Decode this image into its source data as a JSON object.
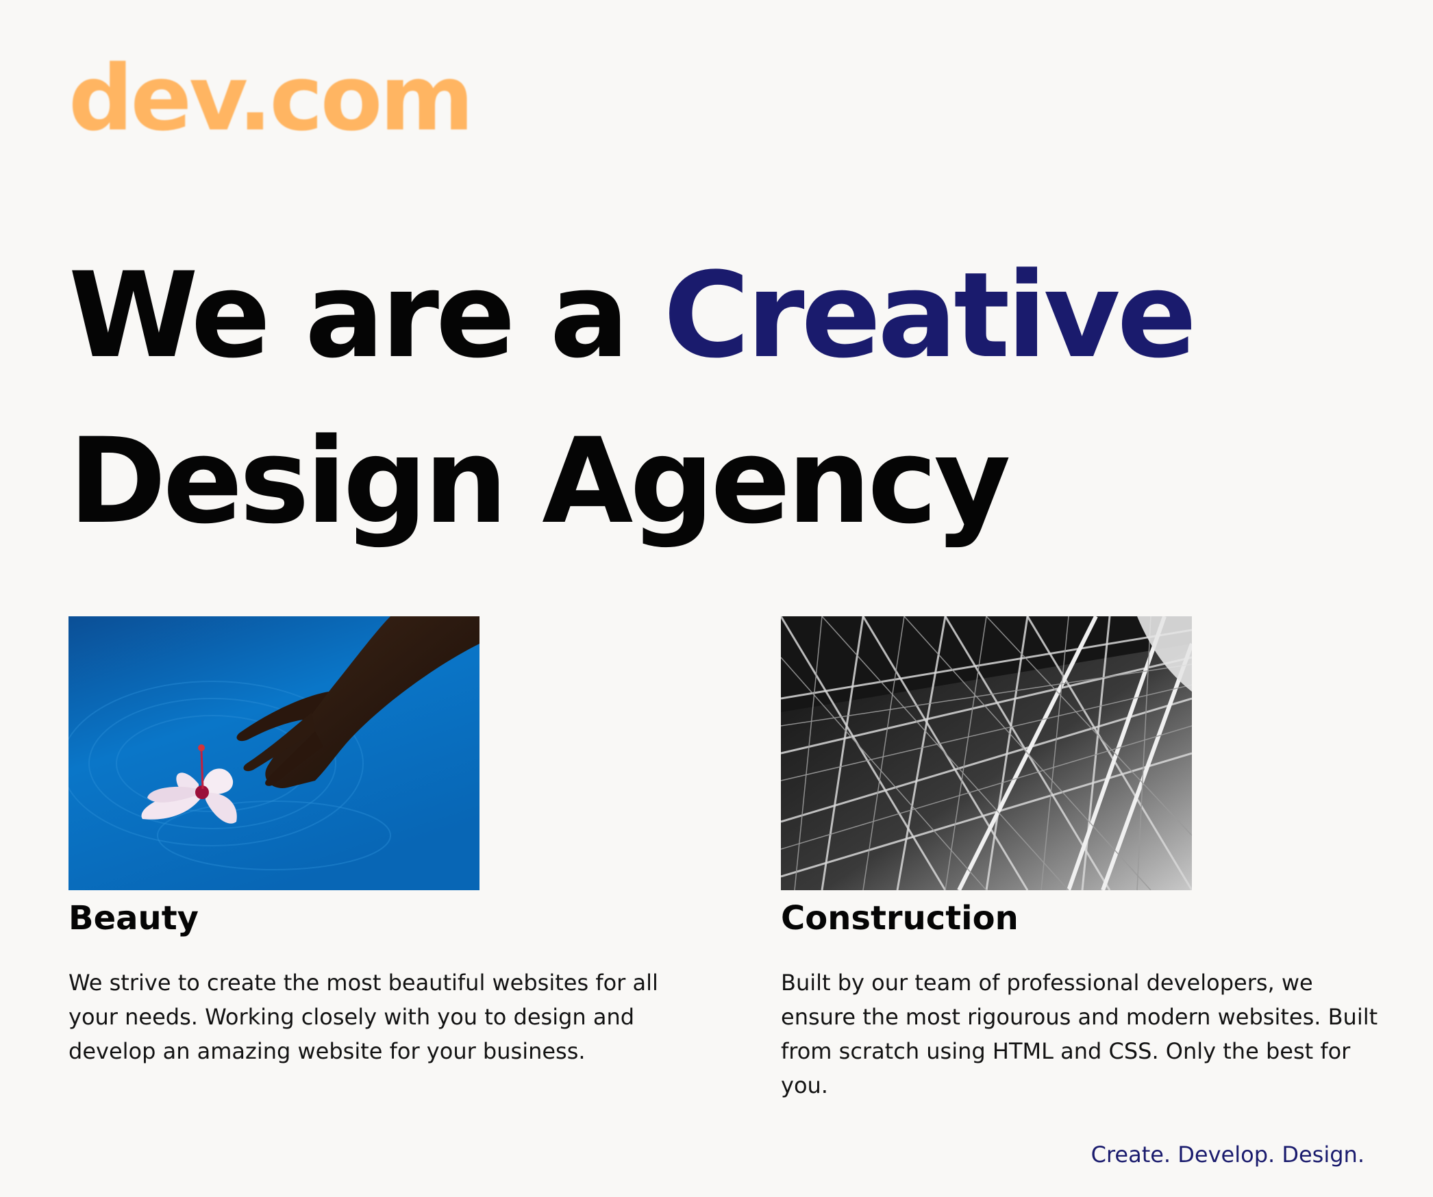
{
  "brand": {
    "logo": "dev.com",
    "color": "#ffb562"
  },
  "hero": {
    "line1_before": "We are a ",
    "line1_accent": "Creative",
    "line2": "Design Agency",
    "accent_color": "#1a1b6d"
  },
  "cards": [
    {
      "image_icon": "hand-with-hibiscus-in-water-photo",
      "title": "Beauty",
      "description": "We strive to create the most beautiful websites for all your needs. Working closely with you to design and develop an amazing website for your business."
    },
    {
      "image_icon": "steel-truss-structure-photo",
      "title": "Construction",
      "description": "Built by our team of professional developers, we ensure the most rigourous and modern websites. Built from scratch using HTML and CSS. Only the best for you."
    }
  ],
  "footer": {
    "tagline": "Create. Develop. Design."
  }
}
